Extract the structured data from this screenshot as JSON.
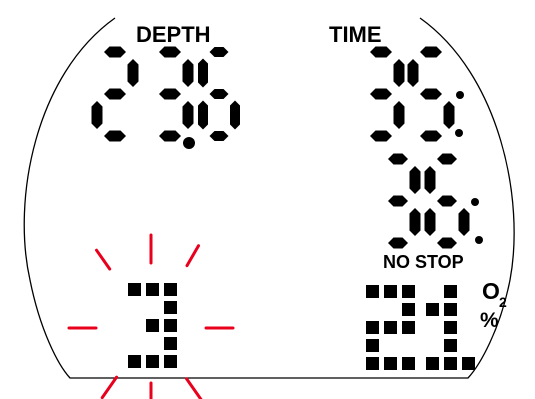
{
  "depth": {
    "label": "DEPTH",
    "value": "23.6",
    "digits": [
      "2",
      "3",
      "6"
    ]
  },
  "dive_time": {
    "label": "TIME",
    "minutes": "35",
    "seconds": "36"
  },
  "deco": {
    "status": "NO STOP",
    "indicator": "3",
    "indicator_state": "flashing",
    "indicator_color": "#e8001c"
  },
  "gas": {
    "o2_percent": "21",
    "o2_label": "O",
    "o2_subscript": "2",
    "unit": "%"
  },
  "colors": {
    "segments": "#000000",
    "background": "#ffffff",
    "alert": "#e8001c"
  }
}
